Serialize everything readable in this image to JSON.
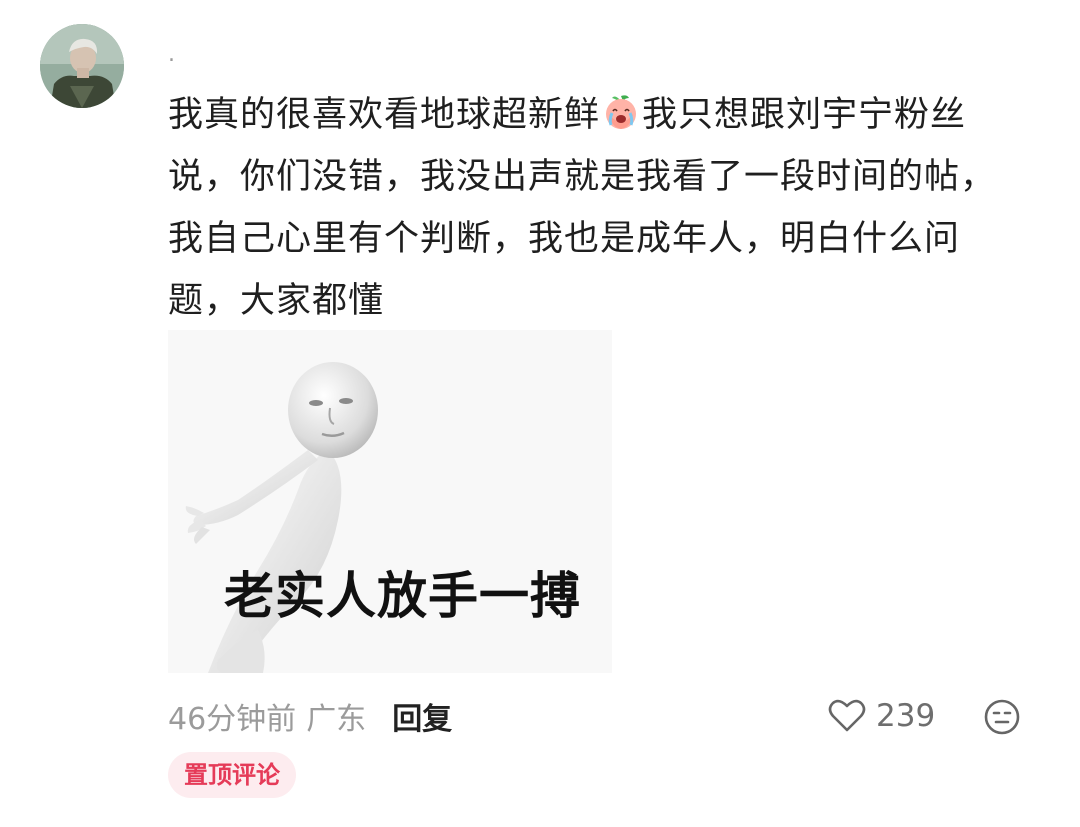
{
  "comment": {
    "username": ".",
    "text_part1": "我真的很喜欢看地球超新鲜",
    "emoji": "crying-peach-emoji",
    "text_part2": "我只想跟刘宇宁粉丝说，你们没错，我没出声就是我看了一段时间的帖，我自己心里有个判断，我也是成年人，明白什么问题，大家都懂",
    "meme_caption": "老实人放手一搏",
    "time": "46分钟前",
    "location": "广东",
    "reply_label": "回复",
    "like_count": "239",
    "pinned_label": "置顶评论"
  },
  "colors": {
    "text": "#1f1f1f",
    "meta": "#9b9b9b",
    "pin_bg": "#fdecef",
    "pin_text": "#e53b58"
  }
}
